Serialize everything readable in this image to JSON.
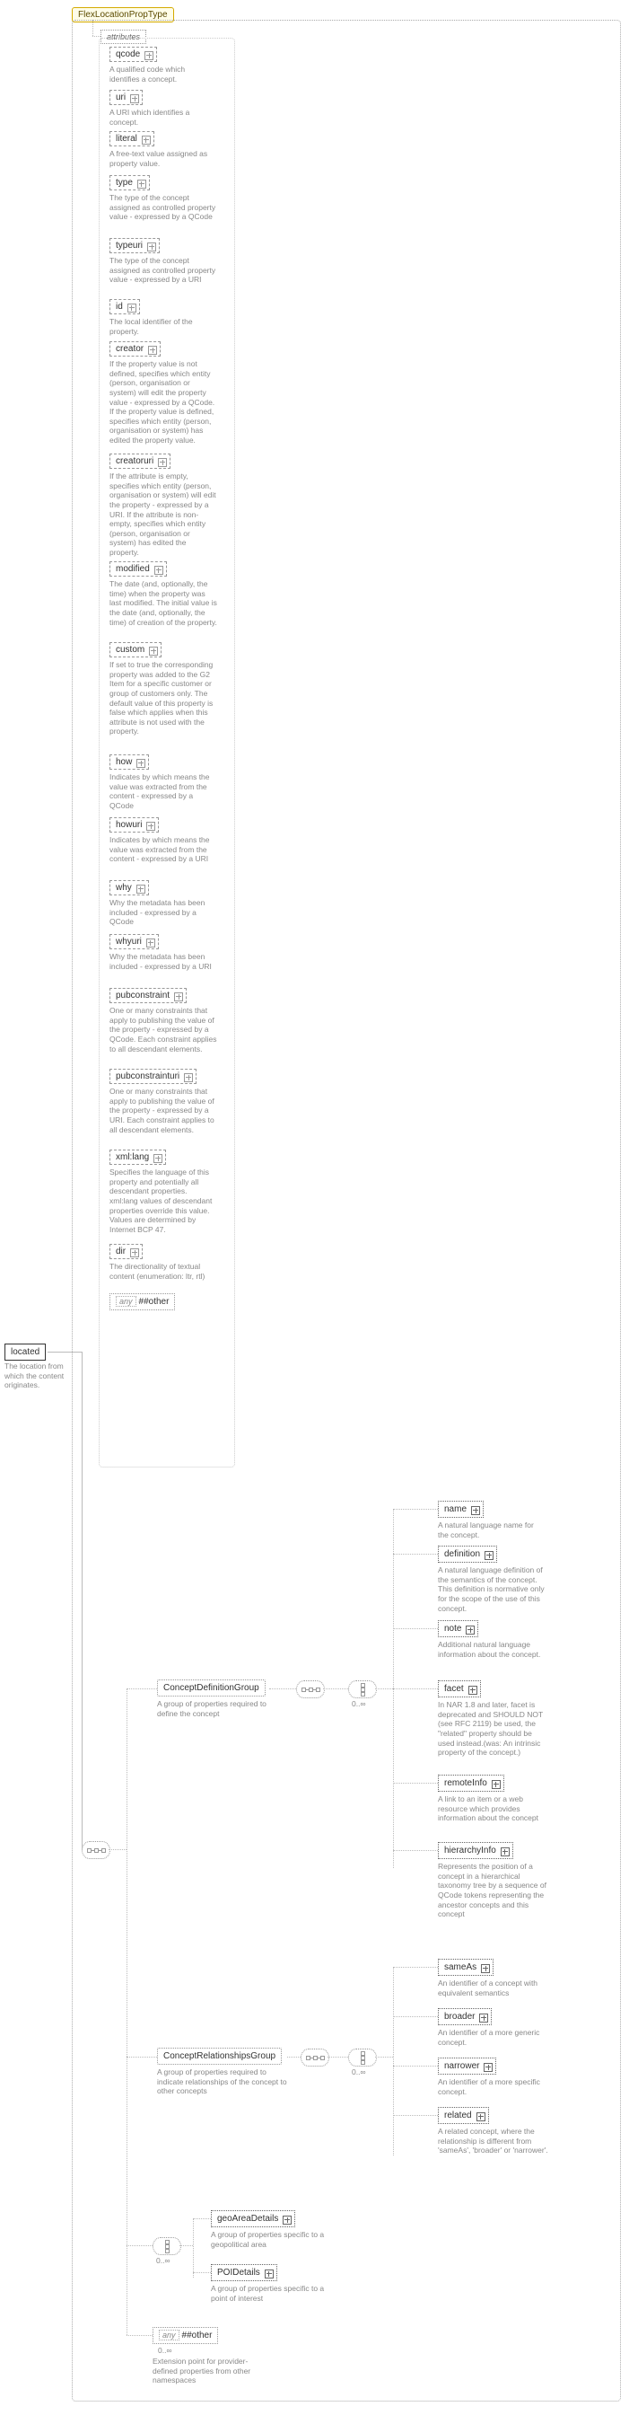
{
  "root_type": "FlexLocationPropType",
  "located": {
    "label": "located",
    "desc": "The location from which the content originates."
  },
  "attributes_label": "attributes",
  "attributes": [
    {
      "name": "qcode",
      "desc": "A qualified code which identifies a concept."
    },
    {
      "name": "uri",
      "desc": "A URI which identifies a concept."
    },
    {
      "name": "literal",
      "desc": "A free-text value assigned as property value."
    },
    {
      "name": "type",
      "desc": "The type of the concept assigned as controlled property value - expressed by a QCode"
    },
    {
      "name": "typeuri",
      "desc": "The type of the concept assigned as controlled property value - expressed by a URI"
    },
    {
      "name": "id",
      "desc": "The local identifier of the property."
    },
    {
      "name": "creator",
      "desc": "If the property value is not defined, specifies which entity (person, organisation or system) will edit the property value - expressed by a QCode. If the property value is defined, specifies which entity (person, organisation or system) has edited the property value."
    },
    {
      "name": "creatoruri",
      "desc": "If the attribute is empty, specifies which entity (person, organisation or system) will edit the property - expressed by a URI. If the attribute is non-empty, specifies which entity (person, organisation or system) has edited the property."
    },
    {
      "name": "modified",
      "desc": "The date (and, optionally, the time) when the property was last modified. The initial value is the date (and, optionally, the time) of creation of the property."
    },
    {
      "name": "custom",
      "desc": "If set to true the corresponding property was added to the G2 Item for a specific customer or group of customers only. The default value of this property is false which applies when this attribute is not used with the property."
    },
    {
      "name": "how",
      "desc": "Indicates by which means the value was extracted from the content - expressed by a QCode"
    },
    {
      "name": "howuri",
      "desc": "Indicates by which means the value was extracted from the content - expressed by a URI"
    },
    {
      "name": "why",
      "desc": "Why the metadata has been included - expressed by a QCode"
    },
    {
      "name": "whyuri",
      "desc": "Why the metadata has been included - expressed by a URI"
    },
    {
      "name": "pubconstraint",
      "desc": "One or many constraints that apply to publishing the value of the property - expressed by a QCode. Each constraint applies to all descendant elements."
    },
    {
      "name": "pubconstrainturi",
      "desc": "One or many constraints that apply to publishing the value of the property - expressed by a URI. Each constraint applies to all descendant elements."
    },
    {
      "name": "xml:lang",
      "desc": "Specifies the language of this property and potentially all descendant properties. xml:lang values of descendant properties override this value. Values are determined by Internet BCP 47."
    },
    {
      "name": "dir",
      "desc": "The directionality of textual content (enumeration: ltr, rtl)"
    }
  ],
  "attr_any": {
    "label": "##other",
    "prefix": "any"
  },
  "occ_unbounded": "0..∞",
  "concept_def_group": {
    "label": "ConceptDefinitionGroup",
    "desc": "A group of properties required to define the concept"
  },
  "concept_rel_group": {
    "label": "ConceptRelationshipsGroup",
    "desc": "A group of properties required to indicate relationships of the concept to other concepts"
  },
  "geo_group": {
    "label": "geoAreaDetails",
    "desc": "A group of properties specific to a geopolitical area"
  },
  "poi_group": {
    "label": "POIDetails",
    "desc": "A group of properties specific to a point of interest"
  },
  "ext_any": {
    "label": "##other",
    "prefix": "any",
    "desc": "Extension point for provider-defined properties from other namespaces"
  },
  "def_children": [
    {
      "name": "name",
      "desc": "A natural language name for the concept."
    },
    {
      "name": "definition",
      "desc": "A natural language definition of the semantics of the concept. This definition is normative only for the scope of the use of this concept."
    },
    {
      "name": "note",
      "desc": "Additional natural language information about the concept."
    },
    {
      "name": "facet",
      "desc": "In NAR 1.8 and later, facet is deprecated and SHOULD NOT (see RFC 2119) be used, the \"related\" property should be used instead.(was: An intrinsic property of the concept.)"
    },
    {
      "name": "remoteInfo",
      "desc": "A link to an item or a web resource which provides information about the concept"
    },
    {
      "name": "hierarchyInfo",
      "desc": "Represents the position of a concept in a hierarchical taxonomy tree by a sequence of QCode tokens representing the ancestor concepts and this concept"
    }
  ],
  "rel_children": [
    {
      "name": "sameAs",
      "desc": "An identifier of a concept with equivalent semantics"
    },
    {
      "name": "broader",
      "desc": "An identifier of a more generic concept."
    },
    {
      "name": "narrower",
      "desc": "An identifier of a more specific concept."
    },
    {
      "name": "related",
      "desc": "A related concept, where the relationship is different from 'sameAs', 'broader' or 'narrower'."
    }
  ]
}
